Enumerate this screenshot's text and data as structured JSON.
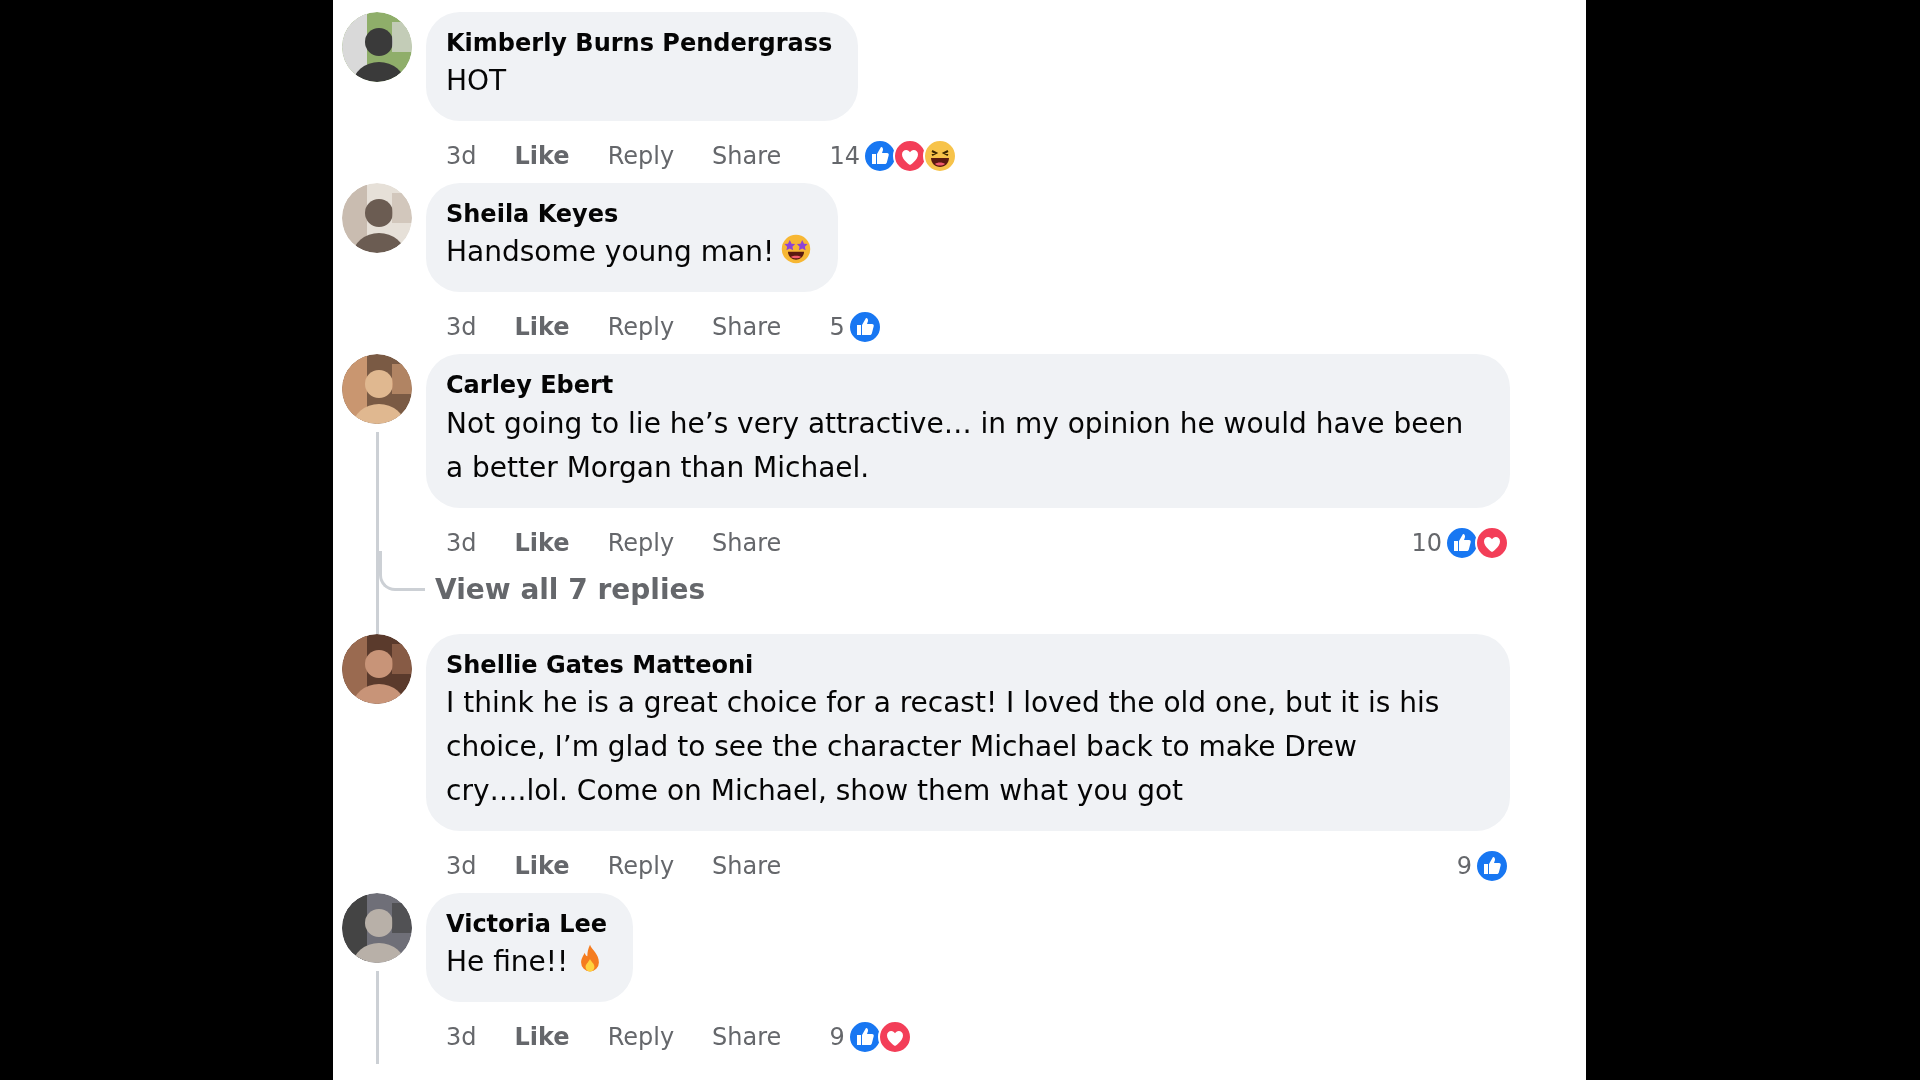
{
  "comments": [
    {
      "author": "Kimberly Burns Pendergrass",
      "text": "HOT",
      "time": "3d",
      "actions": [
        "Like",
        "Reply",
        "Share"
      ],
      "reaction_count": "14",
      "reactions": [
        {
          "kind": "like"
        },
        {
          "kind": "love"
        },
        {
          "kind": "haha"
        }
      ],
      "thread": false
    },
    {
      "author": "Sheila Keyes",
      "text": "Handsome young man!",
      "emoji": {
        "kind": "starstruck"
      },
      "time": "3d",
      "actions": [
        "Like",
        "Reply",
        "Share"
      ],
      "reaction_count": "5",
      "reactions": [
        {
          "kind": "like"
        }
      ],
      "thread": false
    },
    {
      "author": "Carley Ebert",
      "text": "Not going to lie he’s very attractive… in my opinion he would have been a better Morgan than Michael.",
      "time": "3d",
      "actions": [
        "Like",
        "Reply",
        "Share"
      ],
      "reaction_count": "10",
      "reactions": [
        {
          "kind": "like"
        },
        {
          "kind": "love"
        }
      ],
      "thread": true,
      "view_replies": "View all 7 replies"
    },
    {
      "author": "Shellie Gates Matteoni",
      "text": "I think he is a great choice for a recast! I loved the old one, but it is his choice, I’m glad to see the character Michael back to make Drew cry….lol. Come on Michael, show them what you got",
      "time": "3d",
      "actions": [
        "Like",
        "Reply",
        "Share"
      ],
      "reaction_count": "9",
      "reactions": [
        {
          "kind": "like"
        }
      ],
      "thread": false
    },
    {
      "author": "Victoria Lee",
      "text": "He fine!!",
      "emoji": {
        "kind": "fire"
      },
      "time": "3d",
      "actions": [
        "Like",
        "Reply",
        "Share"
      ],
      "reaction_count": "9",
      "reactions": [
        {
          "kind": "like"
        },
        {
          "kind": "love"
        }
      ],
      "thread": true
    }
  ]
}
